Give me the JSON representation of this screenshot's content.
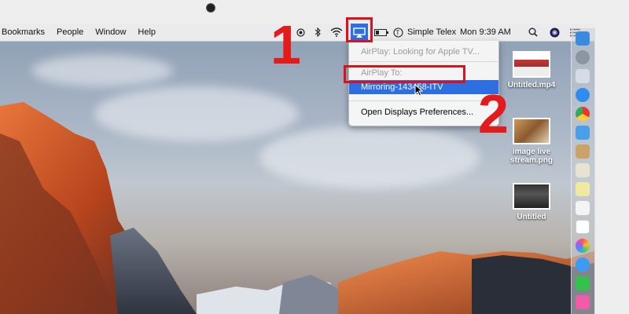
{
  "menubar": {
    "items": [
      "Bookmarks",
      "People",
      "Window",
      "Help"
    ],
    "input_source": "Simple Telex",
    "clock": "Mon 9:39 AM"
  },
  "icons": {
    "record": "record-icon",
    "bluetooth": "bluetooth-icon",
    "wifi": "wifi-icon",
    "airplay": "airplay-icon",
    "battery": "battery-icon",
    "input": "input-source-icon",
    "search": "spotlight-search-icon",
    "siri": "siri-icon",
    "notifications": "notification-center-icon"
  },
  "airplay_menu": {
    "status": "AirPlay: Looking for Apple TV...",
    "section_header": "AirPlay To:",
    "device": "Mirroring-143458-ITV",
    "preferences": "Open Displays Preferences..."
  },
  "annotations": {
    "step1": "1",
    "step2": "2"
  },
  "desktop_files": [
    {
      "name": "Untitled.mp4"
    },
    {
      "name": "image live stream.png"
    },
    {
      "name": "Untitled"
    }
  ],
  "colors": {
    "highlight": "#e0101a",
    "selection": "#2d6fe0",
    "step_number": "#e31b1b"
  }
}
